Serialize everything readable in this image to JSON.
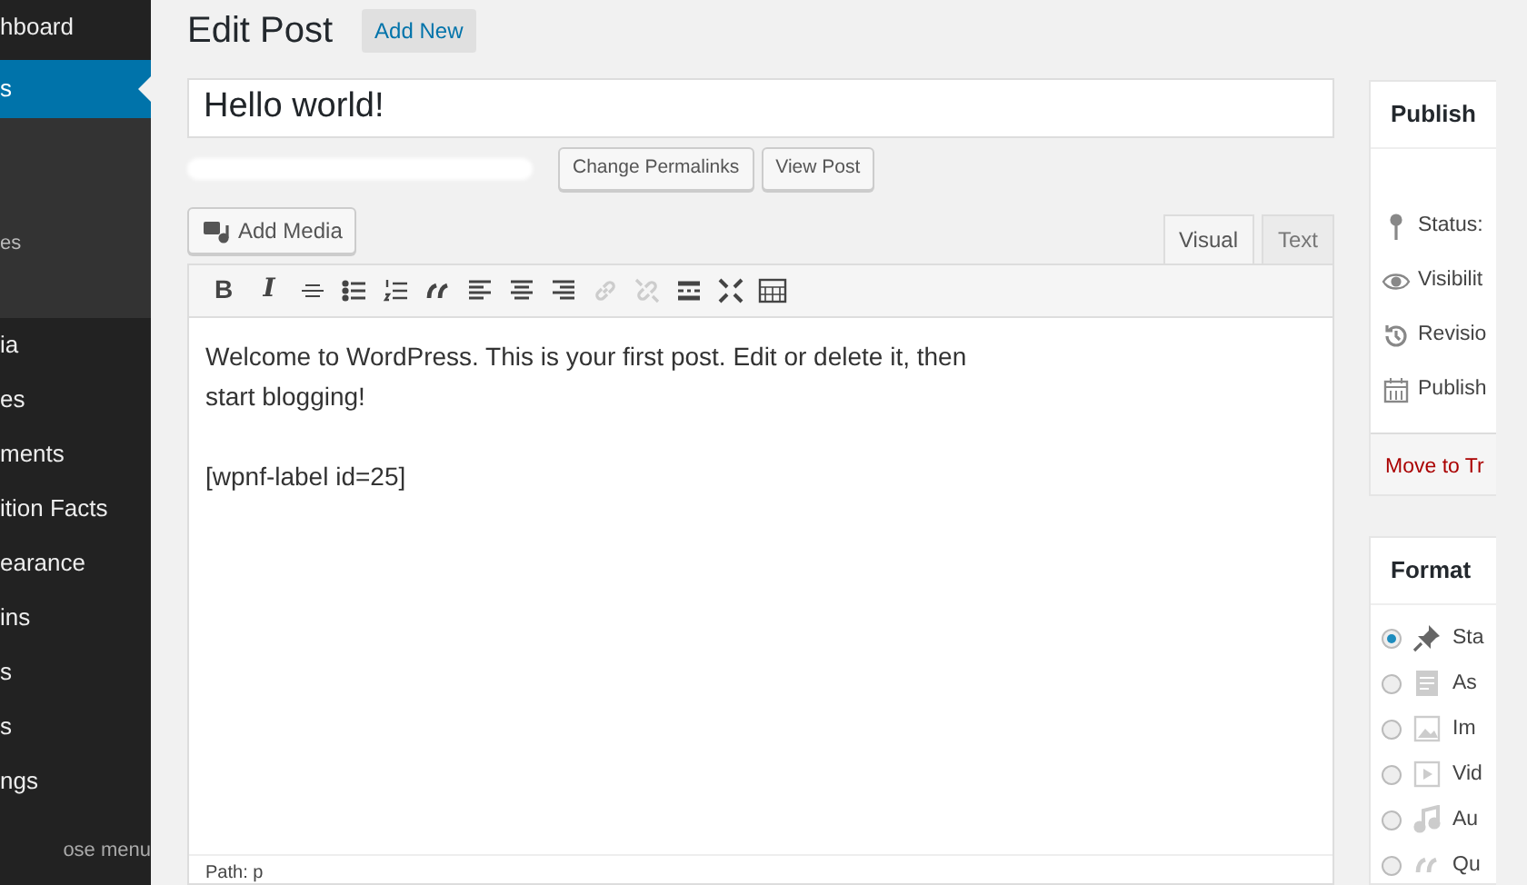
{
  "sidebar": {
    "items": [
      {
        "label": "hboard",
        "selected": false
      },
      {
        "label": "s",
        "selected": true,
        "children": [
          {
            "label": "es"
          }
        ]
      },
      {
        "label": "ia",
        "selected": false
      },
      {
        "label": "es",
        "selected": false
      },
      {
        "label": "ments",
        "selected": false
      },
      {
        "label": "ition Facts",
        "selected": false
      },
      {
        "label": "earance",
        "selected": false
      },
      {
        "label": "ins",
        "selected": false
      },
      {
        "label": "s",
        "selected": false
      },
      {
        "label": "s",
        "selected": false
      },
      {
        "label": "ngs",
        "selected": false
      }
    ],
    "collapse": "ose menu"
  },
  "header": {
    "title": "Edit Post",
    "add_new": "Add New"
  },
  "post_title": "Hello world!",
  "permalink_buttons": [
    "Change Permalinks",
    "View Post"
  ],
  "add_media": "Add Media",
  "editor_tabs": [
    {
      "label": "Visual",
      "selected": true
    },
    {
      "label": "Text",
      "selected": false
    }
  ],
  "toolbar": [
    {
      "kind": "bold",
      "label": "B",
      "disabled": false
    },
    {
      "kind": "italic",
      "label": "I",
      "disabled": false
    },
    {
      "kind": "strike",
      "disabled": false
    },
    {
      "kind": "bullets",
      "disabled": false
    },
    {
      "kind": "numbers",
      "disabled": false
    },
    {
      "kind": "quote",
      "disabled": false
    },
    {
      "kind": "left",
      "disabled": false
    },
    {
      "kind": "center",
      "disabled": false
    },
    {
      "kind": "right",
      "disabled": false
    },
    {
      "kind": "link",
      "disabled": true
    },
    {
      "kind": "unlink",
      "disabled": true
    },
    {
      "kind": "more",
      "disabled": false
    },
    {
      "kind": "fullscreen",
      "disabled": false
    },
    {
      "kind": "kitchen",
      "disabled": false
    }
  ],
  "content": [
    "Welcome to WordPress. This is your first post. Edit or delete it, then start blogging!",
    "[wpnf-label id=25]"
  ],
  "path": "Path: p",
  "publish": {
    "title": "Publish",
    "rows": [
      {
        "kind": "status",
        "label": "Status:"
      },
      {
        "kind": "visibility",
        "label": "Visibilit"
      },
      {
        "kind": "revisions",
        "label": "Revisio"
      },
      {
        "kind": "calendar",
        "label": "Publish"
      }
    ],
    "trash": "Move to Tr"
  },
  "format": {
    "title": "Format",
    "options": [
      {
        "kind": "standard",
        "label": "Sta",
        "selected": true
      },
      {
        "kind": "aside",
        "label": "As",
        "selected": false
      },
      {
        "kind": "image",
        "label": "Im",
        "selected": false
      },
      {
        "kind": "video",
        "label": "Vid",
        "selected": false
      },
      {
        "kind": "audio",
        "label": "Au",
        "selected": false
      },
      {
        "kind": "quote",
        "label": "Qu",
        "selected": false
      }
    ]
  }
}
